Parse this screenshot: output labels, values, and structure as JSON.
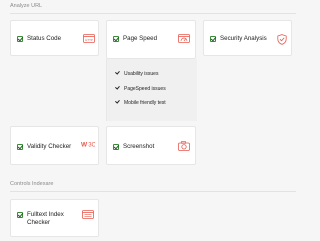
{
  "sections": {
    "analyze_url": "Analyze URL",
    "controls_indexare": "Controls Indexare"
  },
  "cards": {
    "status_code": "Status Code",
    "page_speed": "Page Speed",
    "security_analysis": "Security Analysis",
    "validity_checker": "Validity Checker",
    "screenshot": "Screenshot",
    "fulltext_index_checker_line1": "Fulltext Index",
    "fulltext_index_checker_line2": "Checker"
  },
  "page_speed_options": [
    "Usability issues",
    "PageSpeed issues",
    "Mobile friendly test"
  ],
  "icons": {
    "status_code": "http-window-icon",
    "page_speed": "speed-window-icon",
    "security_analysis": "shield-icon",
    "validity_checker": "w3c-icon",
    "screenshot": "camera-icon",
    "fulltext_index_checker": "index-window-icon"
  },
  "colors": {
    "accent": "#e85a4f",
    "check": "#2e7d32"
  }
}
